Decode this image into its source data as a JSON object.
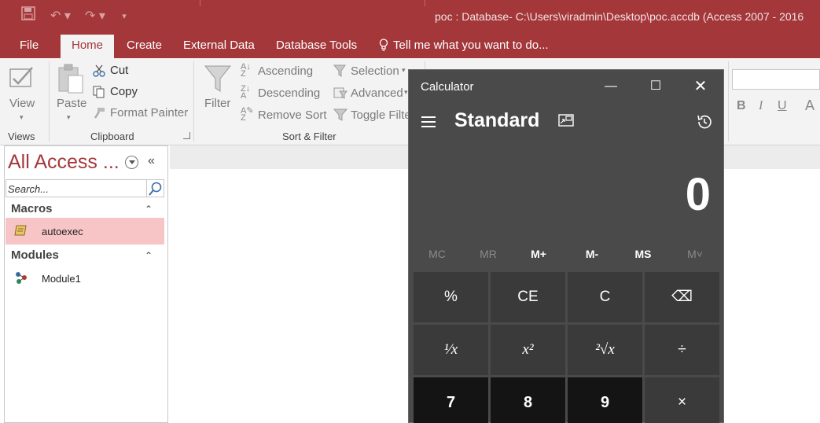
{
  "window": {
    "title": "poc : Database- C:\\Users\\viradmin\\Desktop\\poc.accdb (Access 2007 - 2016"
  },
  "tabs": [
    {
      "label": "File"
    },
    {
      "label": "Home"
    },
    {
      "label": "Create"
    },
    {
      "label": "External Data"
    },
    {
      "label": "Database Tools"
    }
  ],
  "tell_me": "Tell me what you want to do...",
  "ribbon": {
    "views": {
      "view_label": "View",
      "group_label": "Views"
    },
    "clipboard": {
      "paste_label": "Paste",
      "cut_label": "Cut",
      "copy_label": "Copy",
      "format_painter_label": "Format Painter",
      "group_label": "Clipboard"
    },
    "sort_filter": {
      "filter_label": "Filter",
      "ascending_label": "Ascending",
      "descending_label": "Descending",
      "remove_sort_label": "Remove Sort",
      "selection_label": "Selection",
      "advanced_label": "Advanced",
      "toggle_filter_label": "Toggle Filte",
      "group_label": "Sort & Filter"
    },
    "text_format": {
      "bold": "B",
      "italic": "I",
      "underline": "U",
      "font_color": "A"
    }
  },
  "nav": {
    "title": "All Access ...",
    "search_placeholder": "Search...",
    "groups": [
      {
        "label": "Macros",
        "items": [
          {
            "label": "autoexec",
            "selected": true
          }
        ]
      },
      {
        "label": "Modules",
        "items": [
          {
            "label": "Module1",
            "selected": false
          }
        ]
      }
    ]
  },
  "calculator": {
    "title": "Calculator",
    "mode": "Standard",
    "display": "0",
    "memory": [
      {
        "label": "MC",
        "enabled": false
      },
      {
        "label": "MR",
        "enabled": false
      },
      {
        "label": "M+",
        "enabled": true
      },
      {
        "label": "M-",
        "enabled": true
      },
      {
        "label": "MS",
        "enabled": true
      },
      {
        "label": "M˅",
        "enabled": false
      }
    ],
    "keys_row1": [
      "%",
      "CE",
      "C",
      "⌫"
    ],
    "keys_row2": [
      "¹⁄x",
      "x²",
      "²√x",
      "÷"
    ],
    "keys_row3": [
      "7",
      "8",
      "9",
      "×"
    ]
  },
  "colors": {
    "access_accent": "#a4373a",
    "selected_item": "#f8c5c6",
    "calc_bg": "#4a4a4a",
    "calc_key": "#3a3a3a",
    "calc_num_key": "#141414"
  }
}
